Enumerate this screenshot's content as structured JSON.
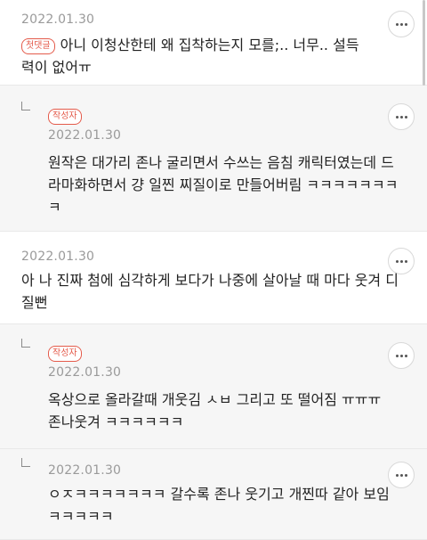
{
  "comments": [
    {
      "date": "2022.01.30",
      "badge": "첫댓글",
      "text": "아니 이청산한테 왜 집착하는지 모를;.. 너무.. 설득력이 없어ㅠ"
    },
    {
      "date": "2022.01.30",
      "badge": "작성자",
      "text": "원작은 대가리 존나 굴리면서 수쓰는 음침 캐릭터였는데 드라마화하면서 걍 일찐 찌질이로 만들어버림 ㅋㅋㅋㅋㅋㅋㅋㅋ"
    },
    {
      "date": "2022.01.30",
      "text": "아 나 진짜 첨에 심각하게 보다가 나중에 살아날 때 마다 웃겨 디질뻔"
    },
    {
      "date": "2022.01.30",
      "badge": "작성자",
      "text": "옥상으로 올라갈때 개웃김 ㅅㅂ 그리고 또 떨어짐 ㅠㅠㅠ 존나웃겨 ㅋㅋㅋㅋㅋㅋ"
    },
    {
      "date": "2022.01.30",
      "text": "ㅇㅈㅋㅋㅋㅋㅋㅋㅋ 갈수록 존나 웃기고 개찐따 같아 보임ㅋㅋㅋㅋㅋ"
    }
  ],
  "icons": {
    "more": "more-options-icon",
    "reply": "reply-arrow-icon"
  },
  "colors": {
    "badge": "#e45b4b",
    "reply_bg": "#f6f6f6",
    "date": "#9a9a9a"
  }
}
